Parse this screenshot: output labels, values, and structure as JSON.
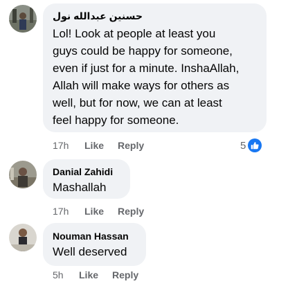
{
  "comments": [
    {
      "author": "حسنين عبدالله نول",
      "text_lines": [
        "Lol! Look at people at least you",
        "guys could be happy for someone,",
        "even if just for a minute. InshaAllah,",
        "Allah will make ways for others as",
        "well, but for now, we can at least",
        "feel happy for someone."
      ],
      "time": "17h",
      "like_label": "Like",
      "reply_label": "Reply",
      "reaction_count": "5",
      "reaction_icon": "like-icon"
    },
    {
      "author": "Danial Zahidi",
      "text_lines": [
        "Mashallah"
      ],
      "time": "17h",
      "like_label": "Like",
      "reply_label": "Reply"
    },
    {
      "author": "Nouman Hassan",
      "text_lines": [
        "Well deserved"
      ],
      "time": "5h",
      "like_label": "Like",
      "reply_label": "Reply"
    }
  ],
  "colors": {
    "bubble": "#f0f2f5",
    "meta_text": "#65676b",
    "accent": "#1877f2"
  }
}
